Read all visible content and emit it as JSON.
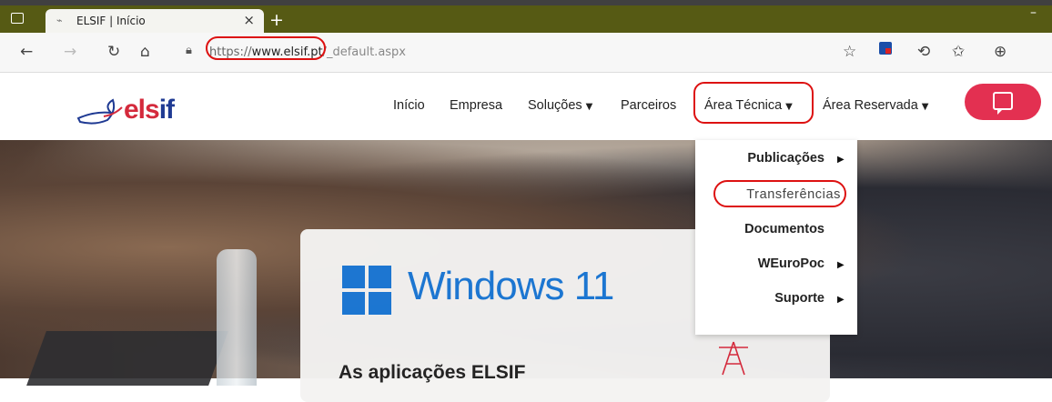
{
  "browser": {
    "tab_favicon": "⌁",
    "tab_title": "ELSIF | Início",
    "tab_close": "×",
    "new_tab": "+",
    "minimize": "–",
    "url_protocol": "https://",
    "url_domain": "www.elsif.pt",
    "url_path": "/_default.aspx",
    "toolbar_icons": [
      "back-icon",
      "forward-icon",
      "reload-icon",
      "home-icon",
      "lock-icon",
      "favorite-star-icon",
      "extension-icon",
      "copilot-icon",
      "favorites-icon",
      "collections-icon"
    ]
  },
  "site": {
    "logo_main": "els",
    "logo_accent": "if",
    "nav": [
      {
        "label": "Início",
        "caret": ""
      },
      {
        "label": "Empresa",
        "caret": ""
      },
      {
        "label": "Soluções",
        "caret": "▼"
      },
      {
        "label": "Parceiros",
        "caret": ""
      },
      {
        "label": "Área Técnica",
        "caret": "▼"
      },
      {
        "label": "Área Reservada",
        "caret": "▼"
      }
    ],
    "dropdown": [
      {
        "label": "Publicações",
        "arrow": "▶"
      },
      {
        "label": "Transferências",
        "arrow": ""
      },
      {
        "label": "Documentos",
        "arrow": ""
      },
      {
        "label": "WEuroPoc",
        "arrow": "▶"
      },
      {
        "label": "Suporte",
        "arrow": "▶"
      }
    ]
  },
  "hero": {
    "product": "Windows 11",
    "headline": "As aplicações ELSIF"
  },
  "colors": {
    "tab_strip": "#565a14",
    "brand_red": "#d42a3c",
    "brand_blue": "#1f3a93",
    "windows_blue": "#1b78d6",
    "chat_button": "#e33051",
    "highlight_circle": "#dd1111"
  }
}
